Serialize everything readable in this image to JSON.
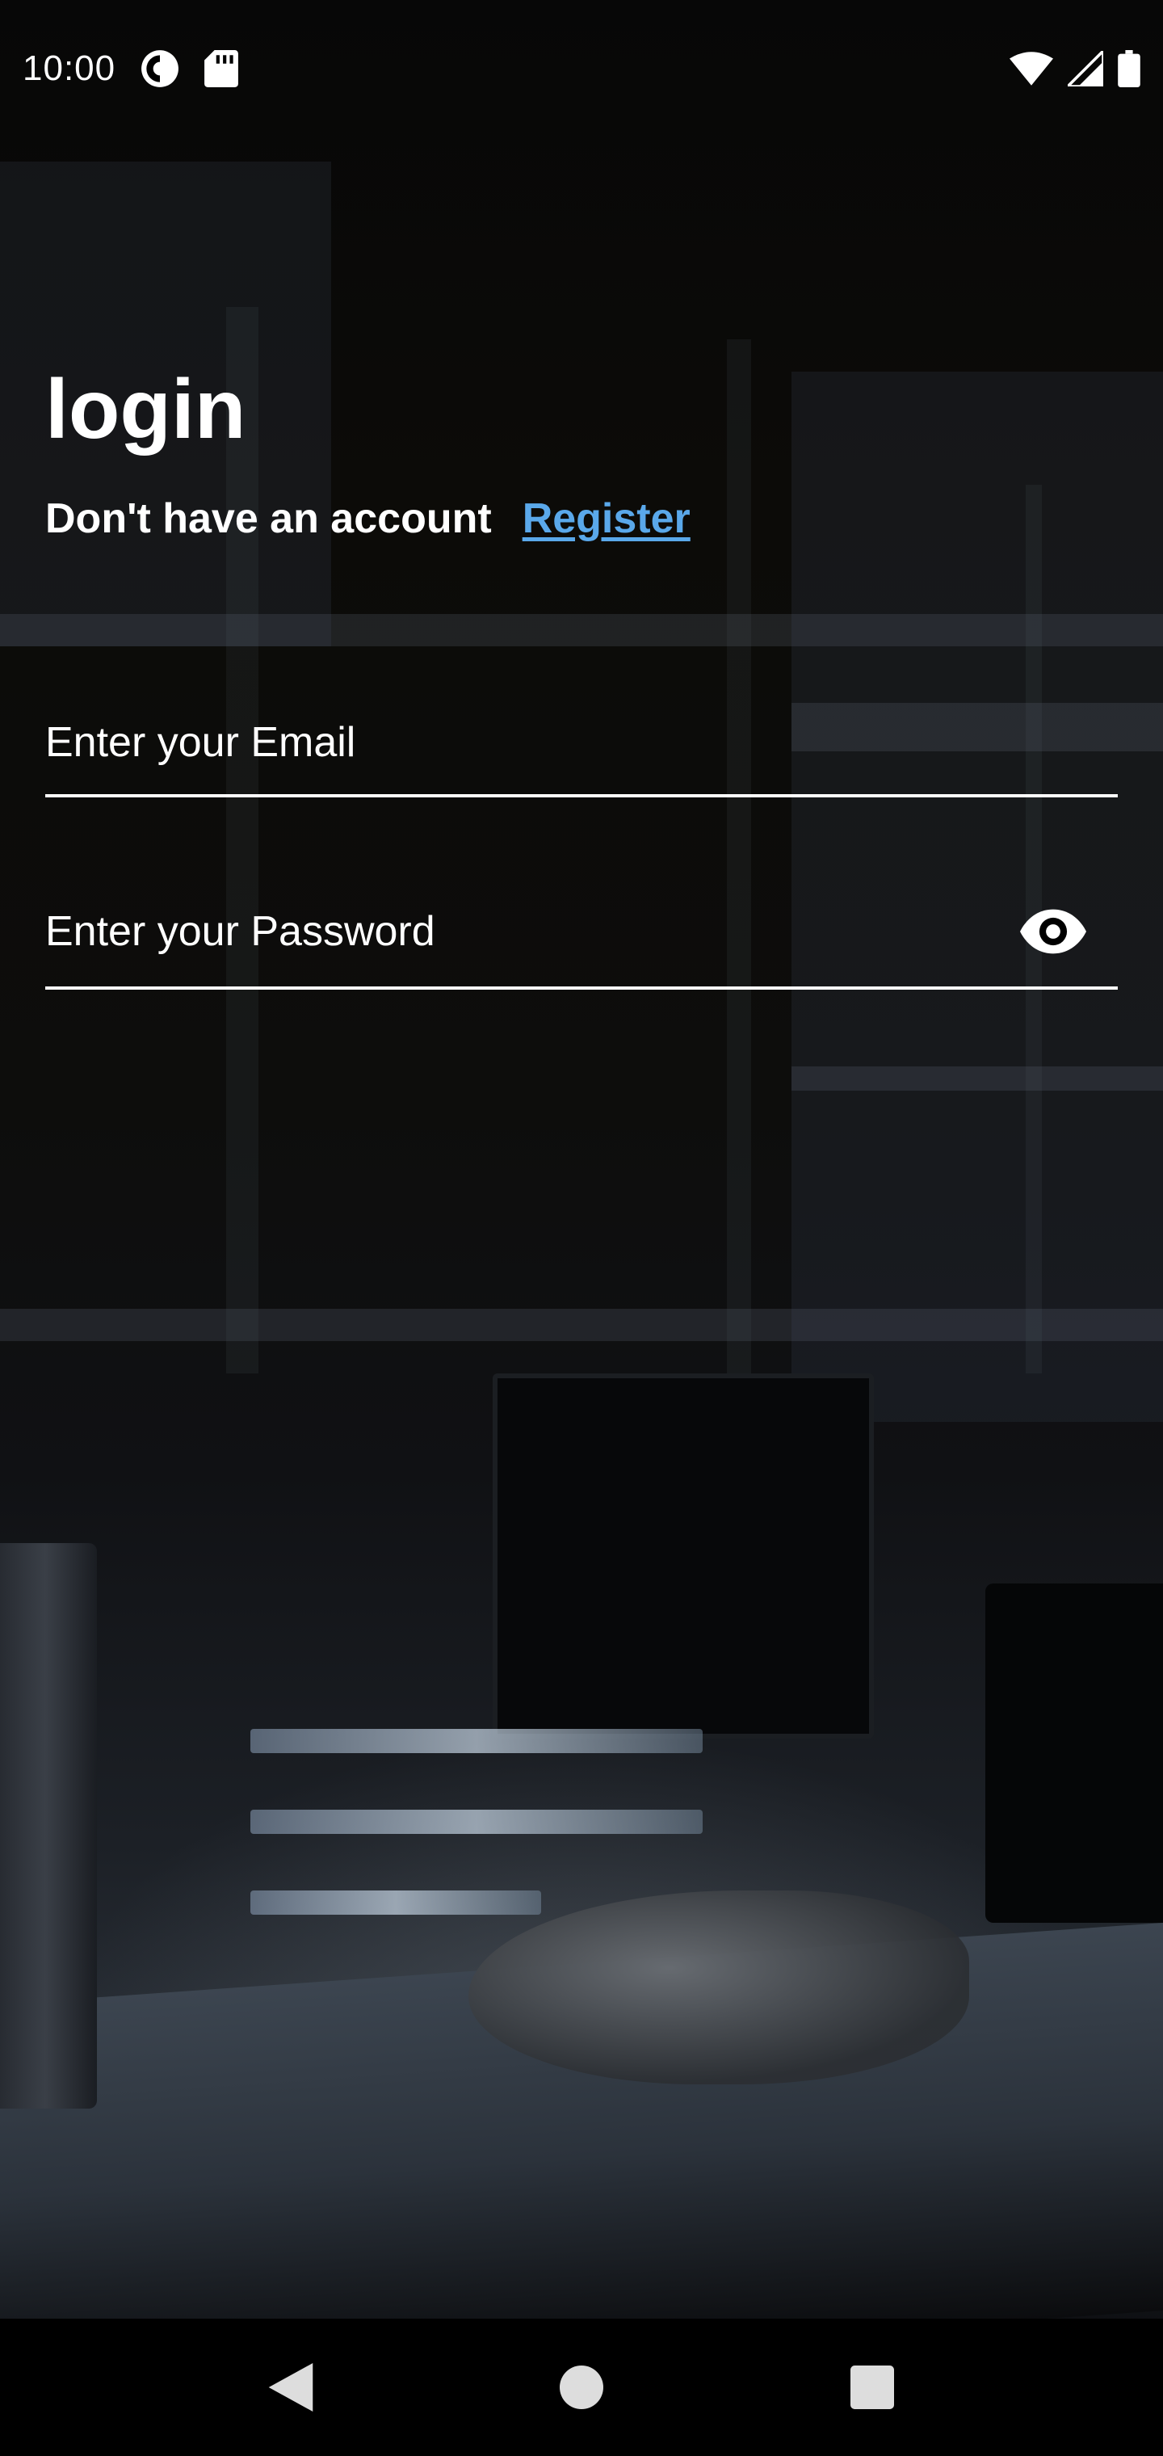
{
  "status_bar": {
    "time": "10:00",
    "left_icons": [
      "screen-record-icon",
      "sd-card-icon"
    ],
    "right_icons": [
      "wifi-icon",
      "cell-signal-icon",
      "battery-icon"
    ]
  },
  "login": {
    "title": "login",
    "no_account_text": "Don't have an account",
    "register_label": "Register",
    "email_placeholder": "Enter your Email",
    "password_placeholder": "Enter your Password",
    "password_toggle_icon": "eye-icon"
  },
  "nav_bar": {
    "buttons": [
      "back-icon",
      "home-icon",
      "recents-icon"
    ]
  },
  "colors": {
    "link": "#5aa8ea",
    "text": "#ffffff",
    "background": "#000000"
  }
}
